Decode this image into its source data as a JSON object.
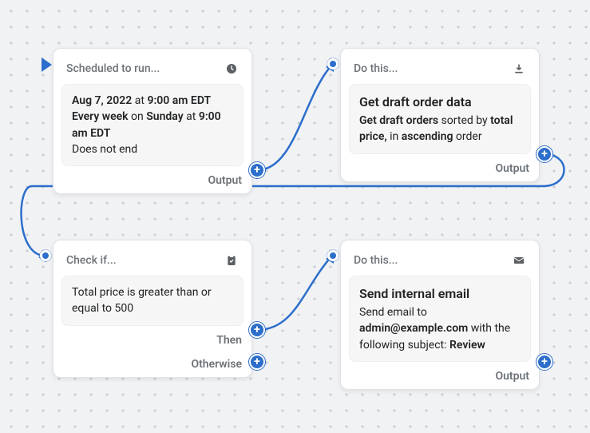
{
  "nodes": {
    "trigger": {
      "title": "Scheduled to run...",
      "date": "Aug 7, 2022",
      "at": "at",
      "time1": "9:00 am EDT",
      "freq": "Every week",
      "on": "on",
      "day": "Sunday",
      "at2": "at",
      "time2": "9:00 am EDT",
      "end": "Does not end",
      "output": "Output"
    },
    "action1": {
      "title": "Do this...",
      "heading": "Get draft order data",
      "line_a1": "Get draft orders",
      "line_a2": " sorted by ",
      "line_a3": "total price,",
      "line_a4": " in ",
      "line_a5": "ascending",
      "line_a6": " order",
      "output": "Output"
    },
    "cond": {
      "title": "Check if...",
      "body": "Total price is greater than or equal to 500",
      "then": "Then",
      "otherwise": "Otherwise"
    },
    "action2": {
      "title": "Do this...",
      "heading": "Send internal email",
      "line_b1": "Send email to ",
      "line_b2": "admin@example.com",
      "line_b3": " with the following subject: ",
      "line_b4": "Review",
      "output": "Output"
    }
  }
}
